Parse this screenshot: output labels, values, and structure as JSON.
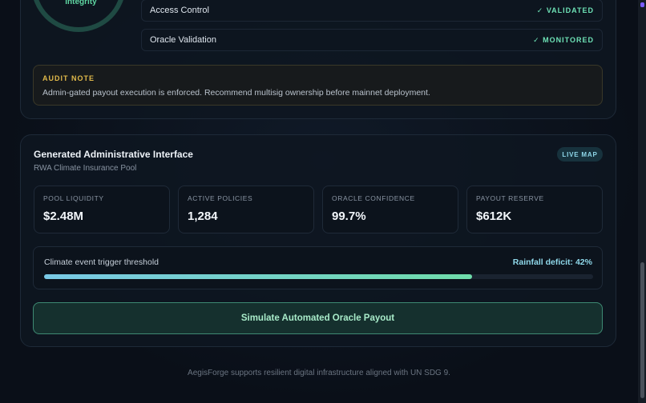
{
  "integrity": {
    "label": "Integrity"
  },
  "checks": [
    {
      "name": "Access Control",
      "status": "✓ VALIDATED"
    },
    {
      "name": "Oracle Validation",
      "status": "✓ MONITORED"
    }
  ],
  "audit_note": {
    "title": "AUDIT NOTE",
    "text": "Admin-gated payout execution is enforced. Recommend multisig ownership before mainnet deployment."
  },
  "interface": {
    "title": "Generated Administrative Interface",
    "subtitle": "RWA Climate Insurance Pool",
    "badge": "LIVE MAP"
  },
  "metrics": [
    {
      "label": "POOL LIQUIDITY",
      "value": "$2.48M"
    },
    {
      "label": "ACTIVE POLICIES",
      "value": "1,284"
    },
    {
      "label": "ORACLE CONFIDENCE",
      "value": "99.7%"
    },
    {
      "label": "PAYOUT RESERVE",
      "value": "$612K"
    }
  ],
  "threshold": {
    "label": "Climate event trigger threshold",
    "deficit": "Rainfall deficit: 42%",
    "progress_percent": 78
  },
  "action": {
    "label": "Simulate Automated Oracle Payout"
  },
  "footer": {
    "text": "AegisForge supports resilient digital infrastructure aligned with UN SDG 9."
  },
  "colors": {
    "accent_green": "#6ee2b6",
    "accent_cyan": "#8fd8ea",
    "audit_gold": "#e0b94a"
  }
}
